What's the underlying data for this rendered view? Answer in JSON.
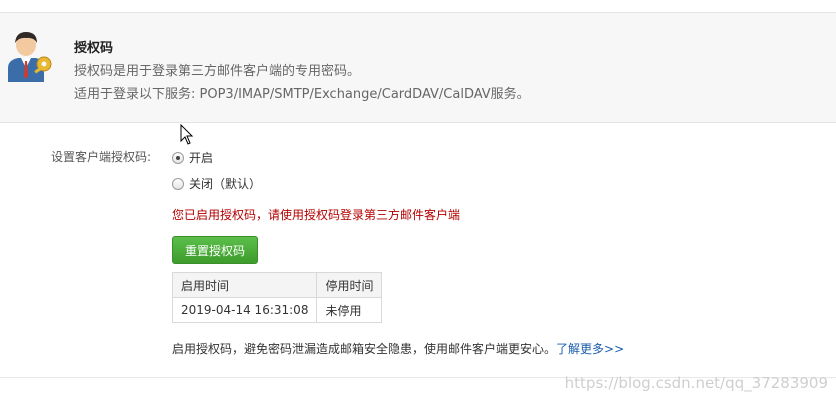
{
  "info": {
    "title": "授权码",
    "line1": "授权码是用于登录第三方邮件客户端的专用密码。",
    "line2": "适用于登录以下服务: POP3/IMAP/SMTP/Exchange/CardDAV/CalDAV服务。",
    "icon": "user-key-icon"
  },
  "setting": {
    "label": "设置客户端授权码:",
    "options": [
      {
        "label": "开启",
        "checked": true
      },
      {
        "label": "关闭（默认）",
        "checked": false
      }
    ],
    "status": "您已启用授权码，请使用授权码登录第三方邮件客户端"
  },
  "reset_button": "重置授权码",
  "table": {
    "headers": [
      "启用时间",
      "停用时间"
    ],
    "rows": [
      [
        "2019-04-14 16:31:08",
        "未停用"
      ]
    ]
  },
  "footer": {
    "note": "启用授权码，避免密码泄漏造成邮箱安全隐患，使用邮件客户端更安心。",
    "link": "了解更多>>"
  },
  "watermark": "https://blog.csdn.net/qq_37283909",
  "colors": {
    "accent_green": "#3d9c2c",
    "status_red": "#b30000",
    "link_blue": "#1a5dab"
  }
}
